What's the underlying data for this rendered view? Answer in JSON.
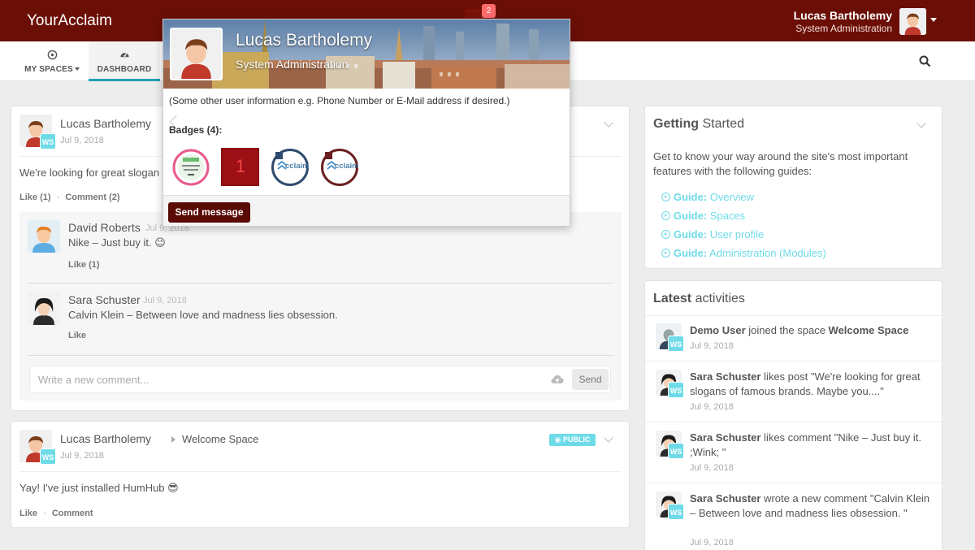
{
  "brand": "YourAcclaim",
  "notifications": {
    "count": "2"
  },
  "current_user": {
    "name": "Lucas Bartholemy",
    "role": "System Administration"
  },
  "nav": {
    "my_spaces": "MY SPACES",
    "dashboard": "DASHBOARD"
  },
  "posts": [
    {
      "author": "Lucas Bartholemy",
      "date": "Jul 9, 2018",
      "space_badge": "WS",
      "text": "We're looking for great slogan",
      "like_label": "Like (1)",
      "separator": "·",
      "comment_label": "Comment (2)",
      "comments": [
        {
          "author": "David Roberts",
          "date": "Jul 9, 2018",
          "text": "Nike – Just buy it.",
          "emoji": "😉",
          "like": "Like (1)"
        },
        {
          "author": "Sara Schuster",
          "date": "Jul 9, 2018",
          "text": "Calvin Klein – Between love and madness lies obsession.",
          "like": "Like"
        }
      ],
      "comment_placeholder": "Write a new comment...",
      "send_label": "Send"
    },
    {
      "author": "Lucas Bartholemy",
      "space": "Welcome Space",
      "date": "Jul 9, 2018",
      "space_badge": "WS",
      "visibility": "PUBLIC",
      "text": "Yay! I've just installed HumHub",
      "emoji": "😎",
      "like_label": "Like",
      "separator": "·",
      "comment_label": "Comment"
    }
  ],
  "getting_started": {
    "title_bold": "Getting",
    "title_rest": "Started",
    "intro": "Get to know your way around the site's most important features with the following guides:",
    "guide_prefix": "Guide:",
    "guides": [
      "Overview",
      "Spaces",
      "User profile",
      "Administration (Modules)"
    ]
  },
  "latest": {
    "title_bold": "Latest",
    "title_rest": "activities",
    "items": [
      {
        "actor": "Demo User",
        "pre": " joined the space ",
        "target": "Welcome Space",
        "post": "",
        "date": "Jul 9, 2018",
        "badge": "WS"
      },
      {
        "actor": "Sara Schuster",
        "pre": " likes post \"We're looking for great slogans of famous brands. Maybe you....\"",
        "target": "",
        "post": "",
        "date": "Jul 9, 2018",
        "badge": "WS"
      },
      {
        "actor": "Sara Schuster",
        "pre": " likes comment \"Nike – Just buy it. ;Wink; \"",
        "target": "",
        "post": "",
        "date": "Jul 9, 2018",
        "badge": "WS"
      },
      {
        "actor": "Sara Schuster",
        "pre": " wrote a new comment \"Calvin Klein – Between love and madness lies obsession. \"",
        "target": "",
        "post": "",
        "date": "Jul 9, 2018",
        "badge": "WS"
      }
    ]
  },
  "popup": {
    "name": "Lucas Bartholemy",
    "role": "System Administration",
    "info": "(Some other user information e.g. Phone Number or E-Mail address if desired.)",
    "badges_title": "Badges (4):",
    "badge_number": "1",
    "badge_acclaim_1": "cclaim",
    "badge_acclaim_2": "cclaim",
    "send_message": "Send message"
  }
}
